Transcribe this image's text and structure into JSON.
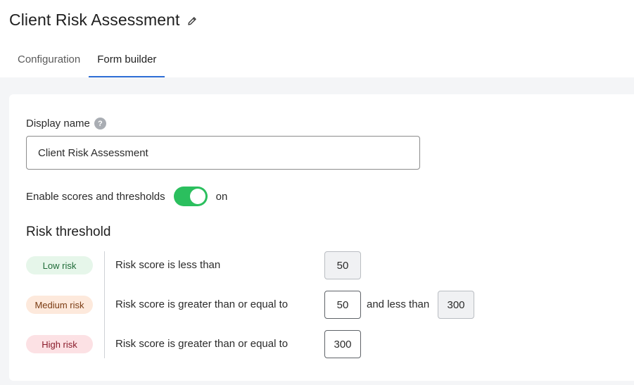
{
  "header": {
    "title": "Client Risk Assessment",
    "edit_icon": "pencil-icon"
  },
  "tabs": [
    {
      "label": "Configuration",
      "active": false
    },
    {
      "label": "Form builder",
      "active": true
    }
  ],
  "form": {
    "display_name_label": "Display name",
    "help_icon": "?",
    "display_name_value": "Client Risk Assessment",
    "toggle_label": "Enable scores and thresholds",
    "toggle_state": "on",
    "accent_color": "#2bbf5e"
  },
  "risk": {
    "title": "Risk threshold",
    "rows": [
      {
        "badge": "Low risk",
        "rule": "Risk score is less than",
        "value": "50"
      },
      {
        "badge": "Medium risk",
        "rule": "Risk score is greater than or equal to",
        "value": "50",
        "and_text": "and less than",
        "upper": "300"
      },
      {
        "badge": "High risk",
        "rule": "Risk score is greater than or equal to",
        "value": "300"
      }
    ]
  }
}
